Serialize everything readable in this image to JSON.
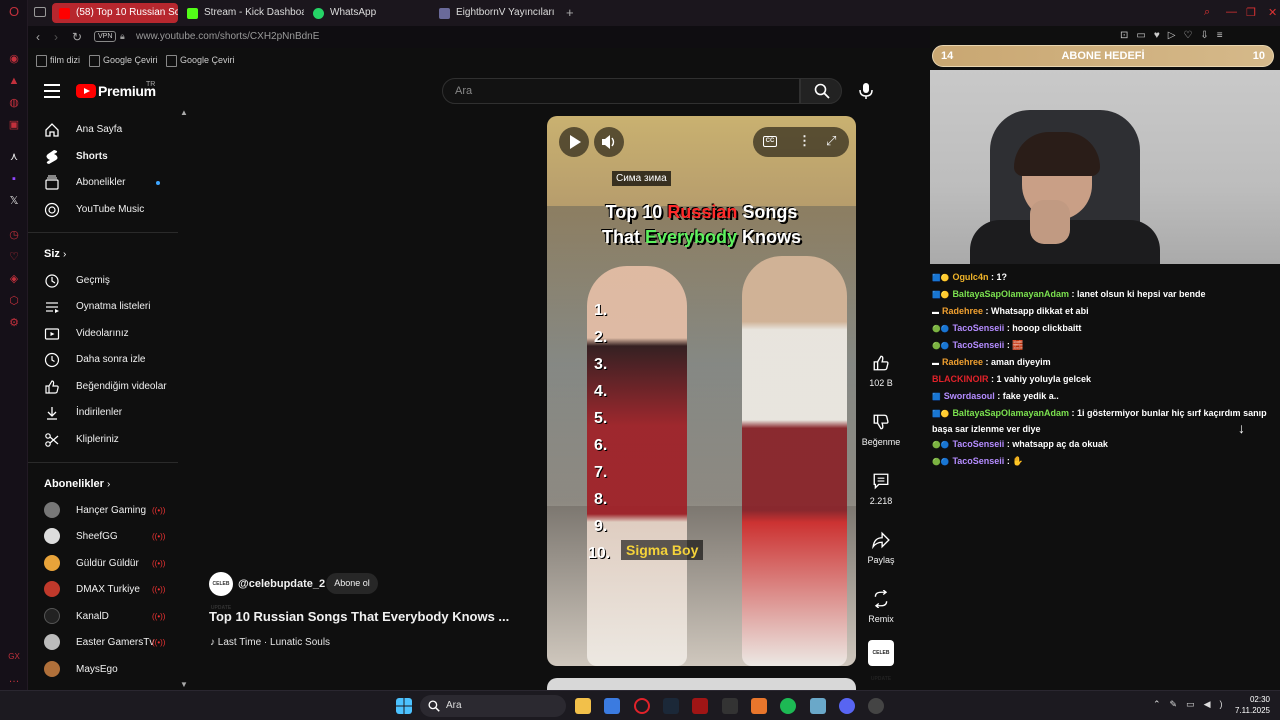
{
  "browser": {
    "tabs": [
      {
        "label": "(58) Top 10 Russian Song",
        "active": true
      },
      {
        "label": "Stream - Kick Dashboard",
        "active": false
      },
      {
        "label": "WhatsApp",
        "active": false
      },
      {
        "label": "EightbornV Yayıncıları",
        "active": false
      }
    ],
    "vpn_label": "VPN",
    "url": "www.youtube.com/shorts/CXH2pNnBdnE",
    "bookmarks": [
      "film dizi",
      "Google Çeviri",
      "Google Çeviri"
    ]
  },
  "youtube": {
    "logo_text": "Premium",
    "logo_region": "TR",
    "search_placeholder": "Ara",
    "sidebar": {
      "main": [
        {
          "label": "Ana Sayfa",
          "icon": "home-icon"
        },
        {
          "label": "Shorts",
          "icon": "shorts-icon"
        },
        {
          "label": "Abonelikler",
          "icon": "subscriptions-icon"
        },
        {
          "label": "YouTube Music",
          "icon": "music-icon"
        }
      ],
      "you_header": "Siz",
      "you": [
        {
          "label": "Geçmiş",
          "icon": "history-icon"
        },
        {
          "label": "Oynatma listeleri",
          "icon": "playlist-icon"
        },
        {
          "label": "Videolarınız",
          "icon": "video-icon"
        },
        {
          "label": "Daha sonra izle",
          "icon": "clock-icon"
        },
        {
          "label": "Beğendiğim videolar",
          "icon": "thumbs-up-icon"
        },
        {
          "label": "İndirilenler",
          "icon": "download-icon"
        },
        {
          "label": "Klipleriniz",
          "icon": "scissors-icon"
        }
      ],
      "subs_header": "Abonelikler",
      "subscriptions": [
        {
          "label": "Hançer Gaming",
          "color": "#777777"
        },
        {
          "label": "SheefGG",
          "color": "#dddddd"
        },
        {
          "label": "Güldür Güldür",
          "color": "#e8a33a"
        },
        {
          "label": "DMAX Turkiye",
          "color": "#c0392b"
        },
        {
          "label": "KanalD",
          "color": "#222222"
        },
        {
          "label": "Easter GamersTv",
          "color": "#bbbbbb"
        },
        {
          "label": "MaysEgo",
          "color": "#b0703a"
        }
      ]
    },
    "short": {
      "caption_top": "Сима зима",
      "title_line1_a": "Top 10 ",
      "title_line1_b": "Russian",
      "title_line1_c": " Songs",
      "title_line2_a": "That ",
      "title_line2_b": "Everybody",
      "title_line2_c": " Knows",
      "ranks": [
        "1.",
        "2.",
        "3.",
        "4.",
        "5.",
        "6.",
        "7.",
        "8.",
        "9.",
        "10."
      ],
      "sigma_label": "Sigma Boy",
      "channel": "@celebupdate_2",
      "channel_avatar_text": "CELEB UPDATE",
      "subscribe_label": "Abone ol",
      "title": "Top 10 Russian Songs That Everybody Knows ...",
      "music": "♪ Last Time · Lunatic Souls",
      "likes": "102 B",
      "dislike_label": "Beğenme",
      "comments": "2.218",
      "share_label": "Paylaş",
      "remix_label": "Remix"
    }
  },
  "stream": {
    "goal_current": "14",
    "goal_label": "ABONE HEDEFİ",
    "goal_target": "10",
    "chat": [
      {
        "user": "Ogulc4n",
        "color": "#f0b429",
        "message": ": 1?"
      },
      {
        "user": "BaltayaSapOlamayanAdam",
        "color": "#7be14f",
        "message": ": lanet olsun ki hepsi var bende"
      },
      {
        "user": "Radehree",
        "color": "#f0a030",
        "message": ": Whatsapp dikkat et abi"
      },
      {
        "user": "TacoSenseii",
        "color": "#b48cff",
        "message": ": hooop clickbaitt"
      },
      {
        "user": "TacoSenseii",
        "color": "#b48cff",
        "message": ": 🧱"
      },
      {
        "user": "Radehree",
        "color": "#f0a030",
        "message": ": aman diyeyim"
      },
      {
        "user": "BLACKINOIR",
        "color": "#e0222a",
        "message": ": 1 vahiy yoluyla gelcek"
      },
      {
        "user": "Swordasoul",
        "color": "#b48cff",
        "message": ": fake yedik a.."
      },
      {
        "user": "BaltayaSapOlamayanAdam",
        "color": "#7be14f",
        "message": ": 1i göstermiyor bunlar hiç sırf kaçırdım sanıp başa sar izlenme ver diye"
      },
      {
        "user": "TacoSenseii",
        "color": "#b48cff",
        "message": ": whatsapp aç da okuak"
      },
      {
        "user": "TacoSenseii",
        "color": "#b48cff",
        "message": ": ✋"
      }
    ]
  },
  "taskbar": {
    "search_label": "Ara",
    "time": "02:30",
    "date": "7.11.2025"
  }
}
